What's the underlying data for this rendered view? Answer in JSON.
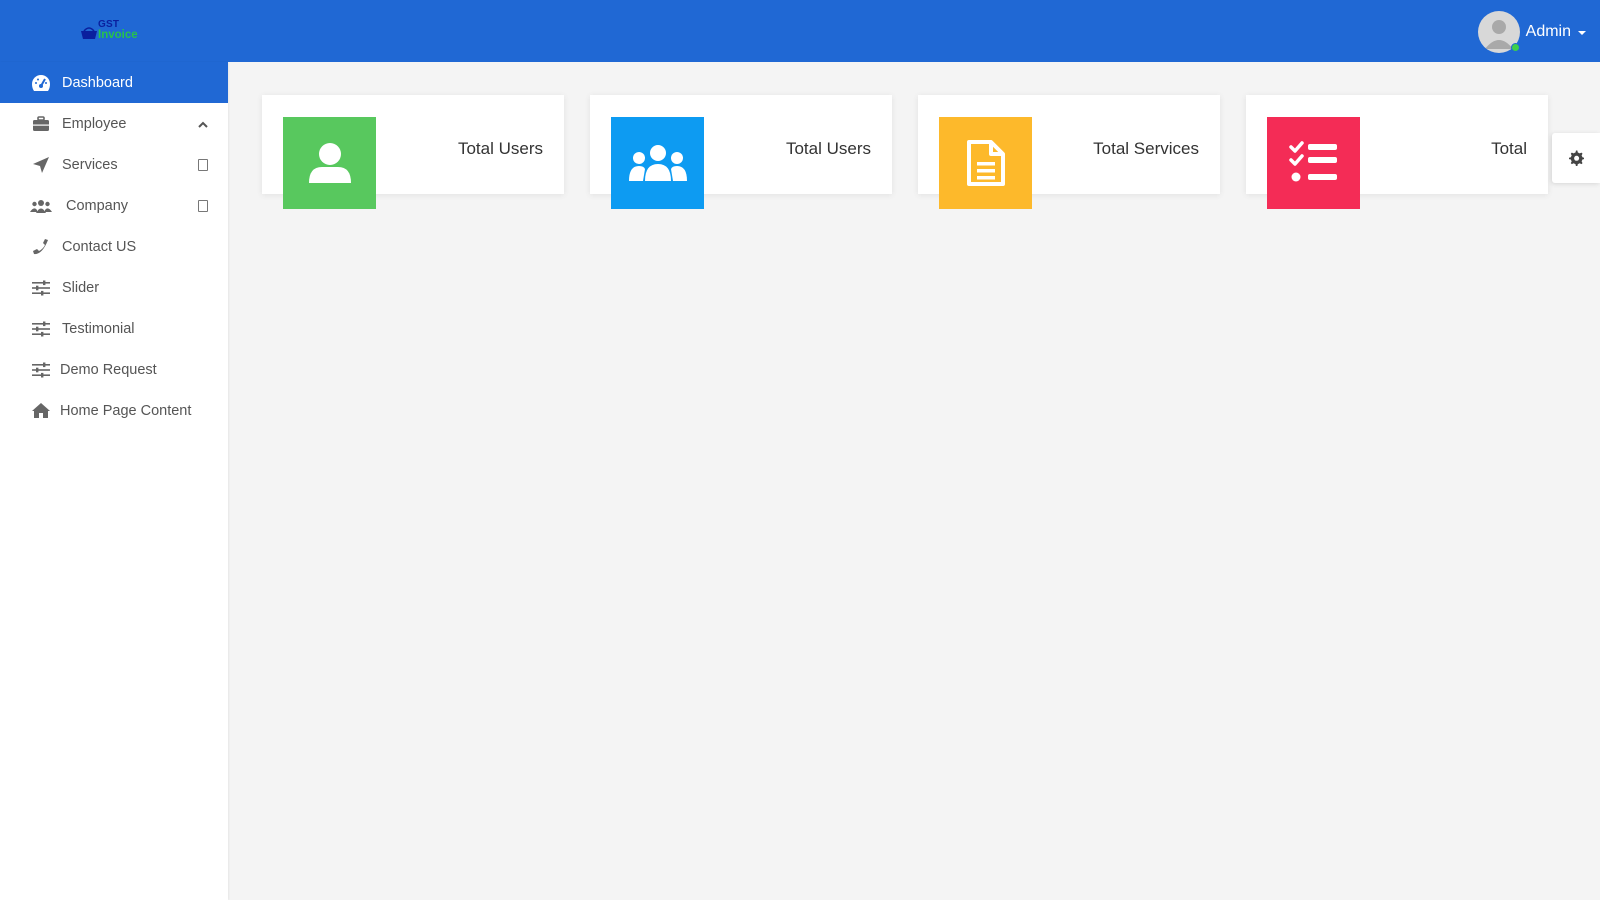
{
  "header": {
    "logo": {
      "line1": "GST",
      "line2": "Invoice"
    },
    "user": {
      "name": "Admin"
    }
  },
  "sidebar": {
    "items": [
      {
        "label": "Dashboard",
        "icon": "dashboard-gauge-icon",
        "active": true
      },
      {
        "label": "Employee",
        "icon": "briefcase-icon",
        "right": "chevron-up-icon"
      },
      {
        "label": "Services",
        "icon": "paper-plane-icon",
        "right": "expand-box-icon"
      },
      {
        "label": "Company",
        "icon": "users-icon",
        "right": "expand-box-icon"
      },
      {
        "label": "Contact US",
        "icon": "phone-icon"
      },
      {
        "label": "Slider",
        "icon": "sliders-icon"
      },
      {
        "label": "Testimonial",
        "icon": "sliders-icon"
      },
      {
        "label": "Demo Request",
        "icon": "sliders-icon"
      },
      {
        "label": "Home Page Content",
        "icon": "home-icon"
      }
    ]
  },
  "cards": [
    {
      "title": "Total Users",
      "icon": "user-icon",
      "color": "#58c85e"
    },
    {
      "title": "Total Users",
      "icon": "users-group-icon",
      "color": "#0d9bf2"
    },
    {
      "title": "Total Services",
      "icon": "file-icon",
      "color": "#fdb92b"
    },
    {
      "title": "Total",
      "icon": "task-list-icon",
      "color": "#f42c56"
    }
  ],
  "colors": {
    "header": "#2068d4",
    "sidebar_active": "#2068d4",
    "background": "#f4f4f4"
  }
}
